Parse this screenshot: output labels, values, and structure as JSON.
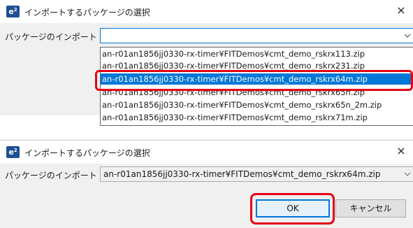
{
  "dialog1": {
    "title": "インポートするパッケージの選択",
    "app_icon_label": "e",
    "app_icon_sup": "2",
    "close_glyph": "×",
    "field_label": "パッケージのインポート",
    "combo_value": "",
    "options": [
      "an-r01an1856jj0330-rx-timer¥FITDemos¥cmt_demo_rskrx113.zip",
      "an-r01an1856jj0330-rx-timer¥FITDemos¥cmt_demo_rskrx231.zip",
      "an-r01an1856jj0330-rx-timer¥FITDemos¥cmt_demo_rskrx64m.zip",
      "an-r01an1856jj0330-rx-timer¥FITDemos¥cmt_demo_rskrx65n.zip",
      "an-r01an1856jj0330-rx-timer¥FITDemos¥cmt_demo_rskrx65n_2m.zip",
      "an-r01an1856jj0330-rx-timer¥FITDemos¥cmt_demo_rskrx71m.zip"
    ],
    "selected_index": 2
  },
  "dialog2": {
    "title": "インポートするパッケージの選択",
    "app_icon_label": "e",
    "app_icon_sup": "2",
    "close_glyph": "×",
    "field_label": "パッケージのインポート",
    "combo_value": "an-r01an1856jj0330-rx-timer¥FITDemos¥cmt_demo_rskrx64m.zip",
    "ok_label": "OK",
    "cancel_label": "キャンセル"
  },
  "icons": {
    "chevron": "chevron-down-icon",
    "close": "close-icon"
  },
  "colors": {
    "accent": "#0078d7",
    "highlight": "#e60012",
    "brand_icon": "#1e4f93"
  }
}
